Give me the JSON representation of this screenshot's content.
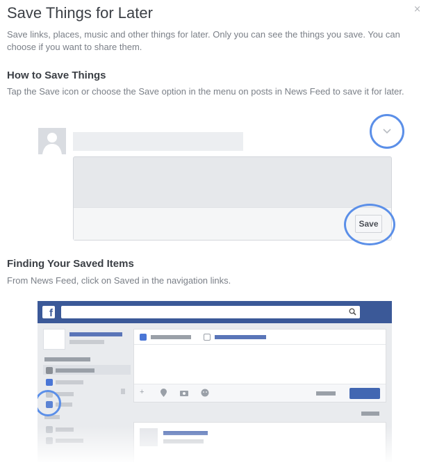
{
  "dialog": {
    "title": "Save Things for Later",
    "close_label": "×",
    "subtitle": "Save links, places, music and other things for later. Only you can see the things you save. You can choose if you want to share them."
  },
  "how_to": {
    "heading": "How to Save Things",
    "text": "Tap the Save icon or choose the Save option in the menu on posts in News Feed to save it for later.",
    "save_button_label": "Save"
  },
  "finding": {
    "heading": "Finding Your Saved Items",
    "text": "From News Feed, click on Saved in the navigation links."
  },
  "screenshot": {
    "logo_letter": "f"
  },
  "colors": {
    "highlight_ring": "#5b8fe8",
    "facebook_blue": "#3b5998"
  },
  "icons": [
    "close-icon",
    "chevron-down-icon",
    "avatar-silhouette-icon",
    "facebook-logo-icon",
    "search-icon",
    "bookmark-icon",
    "camera-icon",
    "location-icon",
    "smiley-icon",
    "add-person-icon"
  ]
}
